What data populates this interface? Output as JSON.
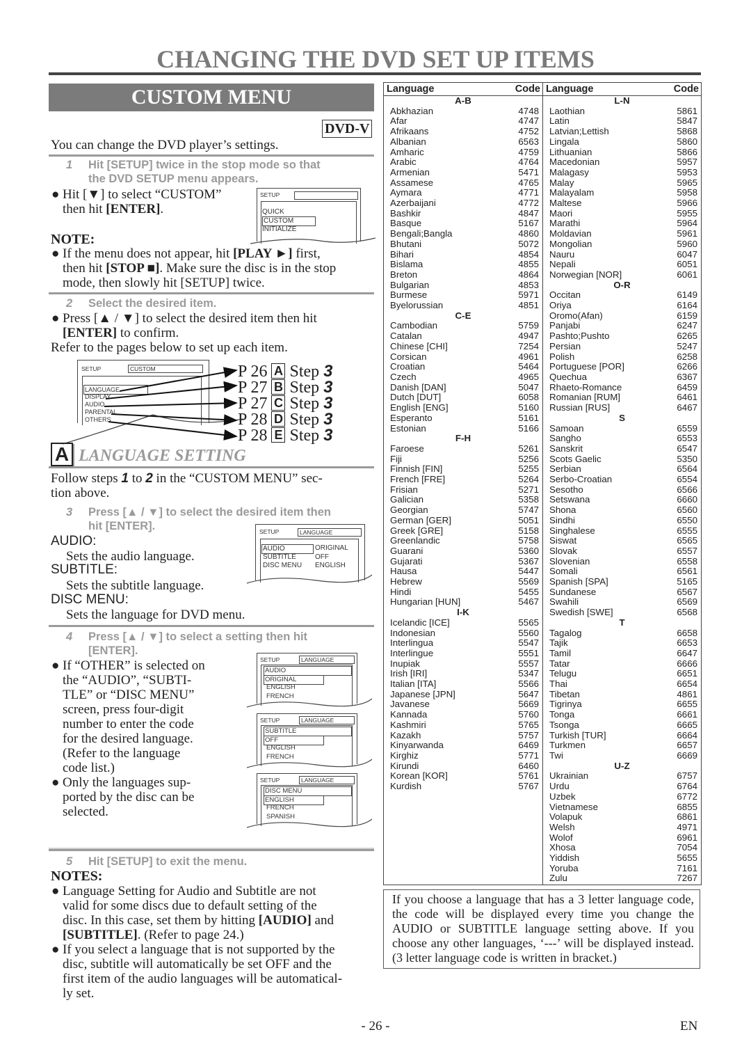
{
  "page": {
    "title": "CHANGING THE DVD SET UP ITEMS",
    "page_number": "- 26 -",
    "language_tag": "EN"
  },
  "custom_menu": {
    "banner": "CUSTOM MENU",
    "disc_badge": "DVD-V",
    "intro": "You can change the DVD player’s settings.",
    "step1": {
      "num": "1",
      "line1": "Hit [SETUP] twice in the stop mode so that",
      "line2": "the DVD SETUP menu appears."
    },
    "step1_bullet": {
      "a": "Hit [",
      "arrow": "▼",
      "b": "] to select “CUSTOM”",
      "c": "then hit ",
      "enter": "[ENTER]",
      "d": "."
    },
    "screen1": {
      "header_label": "SETUP",
      "header_value": "",
      "items": [
        "QUICK",
        "CUSTOM",
        "INITIALIZE"
      ],
      "selected": "CUSTOM"
    },
    "note": {
      "title": "NOTE:",
      "t1": "If the menu does not appear, hit ",
      "play": "[PLAY ►]",
      "t2": " first,",
      "t3": "then hit ",
      "stop": "[STOP ■]",
      "t4": ". Make sure the disc is in the stop",
      "t5": "mode, then slowly hit [SETUP] twice."
    },
    "step2": {
      "num": "2",
      "text": "Select the desired item."
    },
    "step2_bullet": {
      "a": "Press [▲ / ▼] to select the desired item then hit",
      "enter": "[ENTER]",
      "b": " to confirm."
    },
    "refer": "Refer to the pages below to set up each item.",
    "screen2": {
      "header_label": "SETUP",
      "header_value": "CUSTOM",
      "items": [
        "LANGUAGE",
        "DISPLAY",
        "AUDIO",
        "PARENTAL",
        "OTHERS"
      ]
    },
    "refs": [
      {
        "page": "P 26",
        "letter": "A",
        "step_label": "Step",
        "step_num": "3"
      },
      {
        "page": "P 27",
        "letter": "B",
        "step_label": "Step",
        "step_num": "3"
      },
      {
        "page": "P 27",
        "letter": "C",
        "step_label": "Step",
        "step_num": "3"
      },
      {
        "page": "P 28",
        "letter": "D",
        "step_label": "Step",
        "step_num": "3"
      },
      {
        "page": "P 28",
        "letter": "E",
        "step_label": "Step",
        "step_num": "3"
      }
    ]
  },
  "language_setting": {
    "letter": "A",
    "title": "LANGUAGE SETTING",
    "follow": {
      "a": "Follow steps ",
      "s1": "1",
      "b": " to ",
      "s2": "2",
      "c": " in the “CUSTOM MENU” sec-",
      "d": "tion above."
    },
    "step3": {
      "num": "3",
      "line1": "Press [▲ / ▼] to select the desired item then",
      "line2": "hit [ENTER]."
    },
    "items": [
      {
        "label": "AUDIO:",
        "desc": "Sets the audio language."
      },
      {
        "label": "SUBTITLE:",
        "desc": "Sets the subtitle language."
      },
      {
        "label": "DISC MENU:",
        "desc": "Sets the language for DVD menu."
      }
    ],
    "screen3": {
      "header_label": "SETUP",
      "header_value": "LANGUAGE",
      "rows": [
        {
          "name": "AUDIO",
          "value": "ORIGINAL"
        },
        {
          "name": "SUBTITLE",
          "value": "OFF"
        },
        {
          "name": "DISC MENU",
          "value": "ENGLISH"
        }
      ]
    },
    "step4": {
      "num": "4",
      "line1": "Press [▲ / ▼] to select a setting then hit",
      "line2": "[ENTER]."
    },
    "step4_bullets": [
      [
        "If “OTHER” is selected on",
        "the “AUDIO”, “SUBTI-",
        "TLE” or “DISC MENU”",
        "screen, press four-digit",
        "number to enter the code",
        "for the desired language.",
        "(Refer to the language",
        "code list.)"
      ],
      [
        "Only the languages sup-",
        "ported by the disc can be",
        "selected."
      ]
    ],
    "screens4": [
      {
        "header_label": "SETUP",
        "header_value": "LANGUAGE",
        "title": "AUDIO",
        "options": [
          "ORIGINAL",
          "ENGLISH",
          "FRENCH"
        ]
      },
      {
        "header_label": "SETUP",
        "header_value": "LANGUAGE",
        "title": "SUBTITLE",
        "options": [
          "OFF",
          "ENGLISH",
          "FRENCH"
        ]
      },
      {
        "header_label": "SETUP",
        "header_value": "LANGUAGE",
        "title": "DISC MENU",
        "options": [
          "ENGLISH",
          "FRENCH",
          "SPANISH"
        ]
      }
    ],
    "step5": {
      "num": "5",
      "text": "Hit [SETUP] to exit the menu."
    },
    "notes": {
      "title": "NOTES:",
      "n1": {
        "a": "Language Setting for Audio and Subtitle are not",
        "b": "valid for some discs due to default setting of the",
        "c": "disc. In this case, set them by hitting ",
        "audio": "[AUDIO]",
        "d": " and",
        "subtitle": "[SUBTITLE]",
        "e": ". (Refer to page 24.)"
      },
      "n2": [
        "If you select a language that is not supported by the",
        "disc, subtitle will automatically be set OFF and the",
        "first item of the audio languages will be automatical-",
        "ly set."
      ]
    }
  },
  "language_table": {
    "headers": {
      "language": "Language",
      "code": "Code"
    },
    "columns": [
      [
        {
          "group": "A-B"
        },
        {
          "name": "Abkhazian",
          "code": "4748"
        },
        {
          "name": "Afar",
          "code": "4747"
        },
        {
          "name": "Afrikaans",
          "code": "4752"
        },
        {
          "name": "Albanian",
          "code": "6563"
        },
        {
          "name": "Amharic",
          "code": "4759"
        },
        {
          "name": "Arabic",
          "code": "4764"
        },
        {
          "name": "Armenian",
          "code": "5471"
        },
        {
          "name": "Assamese",
          "code": "4765"
        },
        {
          "name": "Aymara",
          "code": "4771"
        },
        {
          "name": "Azerbaijani",
          "code": "4772"
        },
        {
          "name": "Bashkir",
          "code": "4847"
        },
        {
          "name": "Basque",
          "code": "5167"
        },
        {
          "name": "Bengali;Bangla",
          "code": "4860"
        },
        {
          "name": "Bhutani",
          "code": "5072"
        },
        {
          "name": "Bihari",
          "code": "4854"
        },
        {
          "name": "Bislama",
          "code": "4855"
        },
        {
          "name": "Breton",
          "code": "4864"
        },
        {
          "name": "Bulgarian",
          "code": "4853"
        },
        {
          "name": "Burmese",
          "code": "5971"
        },
        {
          "name": "Byelorussian",
          "code": "4851"
        },
        {
          "group": "C-E"
        },
        {
          "name": "Cambodian",
          "code": "5759"
        },
        {
          "name": "Catalan",
          "code": "4947"
        },
        {
          "name": "Chinese [CHI]",
          "code": "7254"
        },
        {
          "name": "Corsican",
          "code": "4961"
        },
        {
          "name": "Croatian",
          "code": "5464"
        },
        {
          "name": "Czech",
          "code": "4965"
        },
        {
          "name": "Danish [DAN]",
          "code": "5047"
        },
        {
          "name": "Dutch [DUT]",
          "code": "6058"
        },
        {
          "name": "English [ENG]",
          "code": "5160"
        },
        {
          "name": "Esperanto",
          "code": "5161"
        },
        {
          "name": "Estonian",
          "code": "5166"
        },
        {
          "group": "F-H"
        },
        {
          "name": "Faroese",
          "code": "5261"
        },
        {
          "name": "Fiji",
          "code": "5256"
        },
        {
          "name": "Finnish [FIN]",
          "code": "5255"
        },
        {
          "name": "French [FRE]",
          "code": "5264"
        },
        {
          "name": "Frisian",
          "code": "5271"
        },
        {
          "name": "Galician",
          "code": "5358"
        },
        {
          "name": "Georgian",
          "code": "5747"
        },
        {
          "name": "German [GER]",
          "code": "5051"
        },
        {
          "name": "Greek [GRE]",
          "code": "5158"
        },
        {
          "name": "Greenlandic",
          "code": "5758"
        },
        {
          "name": "Guarani",
          "code": "5360"
        },
        {
          "name": "Gujarati",
          "code": "5367"
        },
        {
          "name": "Hausa",
          "code": "5447"
        },
        {
          "name": "Hebrew",
          "code": "5569"
        },
        {
          "name": "Hindi",
          "code": "5455"
        },
        {
          "name": "Hungarian [HUN]",
          "code": "5467"
        },
        {
          "group": "I-K"
        },
        {
          "name": "Icelandic [ICE]",
          "code": "5565"
        },
        {
          "name": "Indonesian",
          "code": "5560"
        },
        {
          "name": "Interlingua",
          "code": "5547"
        },
        {
          "name": "Interlingue",
          "code": "5551"
        },
        {
          "name": "Inupiak",
          "code": "5557"
        },
        {
          "name": "Irish [IRI]",
          "code": "5347"
        },
        {
          "name": "Italian [ITA]",
          "code": "5566"
        },
        {
          "name": "Japanese [JPN]",
          "code": "5647"
        },
        {
          "name": "Javanese",
          "code": "5669"
        },
        {
          "name": "Kannada",
          "code": "5760"
        },
        {
          "name": "Kashmiri",
          "code": "5765"
        },
        {
          "name": "Kazakh",
          "code": "5757"
        },
        {
          "name": "Kinyarwanda",
          "code": "6469"
        },
        {
          "name": "Kirghiz",
          "code": "5771"
        },
        {
          "name": "Kirundi",
          "code": "6460"
        },
        {
          "name": "Korean [KOR]",
          "code": "5761"
        },
        {
          "name": "Kurdish",
          "code": "5767"
        }
      ],
      [
        {
          "group": "L-N"
        },
        {
          "name": "Laothian",
          "code": "5861"
        },
        {
          "name": "Latin",
          "code": "5847"
        },
        {
          "name": "Latvian;Lettish",
          "code": "5868"
        },
        {
          "name": "Lingala",
          "code": "5860"
        },
        {
          "name": "Lithuanian",
          "code": "5866"
        },
        {
          "name": "Macedonian",
          "code": "5957"
        },
        {
          "name": "Malagasy",
          "code": "5953"
        },
        {
          "name": "Malay",
          "code": "5965"
        },
        {
          "name": "Malayalam",
          "code": "5958"
        },
        {
          "name": "Maltese",
          "code": "5966"
        },
        {
          "name": "Maori",
          "code": "5955"
        },
        {
          "name": "Marathi",
          "code": "5964"
        },
        {
          "name": "Moldavian",
          "code": "5961"
        },
        {
          "name": "Mongolian",
          "code": "5960"
        },
        {
          "name": "Nauru",
          "code": "6047"
        },
        {
          "name": "Nepali",
          "code": "6051"
        },
        {
          "name": "Norwegian [NOR]",
          "code": "6061"
        },
        {
          "group": "O-R"
        },
        {
          "name": "Occitan",
          "code": "6149"
        },
        {
          "name": "Oriya",
          "code": "6164"
        },
        {
          "name": "Oromo(Afan)",
          "code": "6159"
        },
        {
          "name": "Panjabi",
          "code": "6247"
        },
        {
          "name": "Pashto;Pushto",
          "code": "6265"
        },
        {
          "name": "Persian",
          "code": "5247"
        },
        {
          "name": "Polish",
          "code": "6258"
        },
        {
          "name": "Portuguese [POR]",
          "code": "6266"
        },
        {
          "name": "Quechua",
          "code": "6367"
        },
        {
          "name": "Rhaeto-Romance",
          "code": "6459"
        },
        {
          "name": "Romanian [RUM]",
          "code": "6461"
        },
        {
          "name": "Russian [RUS]",
          "code": "6467"
        },
        {
          "group": "S"
        },
        {
          "name": "Samoan",
          "code": "6559"
        },
        {
          "name": "Sangho",
          "code": "6553"
        },
        {
          "name": "Sanskrit",
          "code": "6547"
        },
        {
          "name": "Scots Gaelic",
          "code": "5350"
        },
        {
          "name": "Serbian",
          "code": "6564"
        },
        {
          "name": "Serbo-Croatian",
          "code": "6554"
        },
        {
          "name": "Sesotho",
          "code": "6566"
        },
        {
          "name": "Setswana",
          "code": "6660"
        },
        {
          "name": "Shona",
          "code": "6560"
        },
        {
          "name": "Sindhi",
          "code": "6550"
        },
        {
          "name": "Singhalese",
          "code": "6555"
        },
        {
          "name": "Siswat",
          "code": "6565"
        },
        {
          "name": "Slovak",
          "code": "6557"
        },
        {
          "name": "Slovenian",
          "code": "6558"
        },
        {
          "name": "Somali",
          "code": "6561"
        },
        {
          "name": "Spanish [SPA]",
          "code": "5165"
        },
        {
          "name": "Sundanese",
          "code": "6567"
        },
        {
          "name": "Swahili",
          "code": "6569"
        },
        {
          "name": "Swedish [SWE]",
          "code": "6568"
        },
        {
          "group": "T"
        },
        {
          "name": "Tagalog",
          "code": "6658"
        },
        {
          "name": "Tajik",
          "code": "6653"
        },
        {
          "name": "Tamil",
          "code": "6647"
        },
        {
          "name": "Tatar",
          "code": "6666"
        },
        {
          "name": "Telugu",
          "code": "6651"
        },
        {
          "name": "Thai",
          "code": "6654"
        },
        {
          "name": "Tibetan",
          "code": "4861"
        },
        {
          "name": "Tigrinya",
          "code": "6655"
        },
        {
          "name": "Tonga",
          "code": "6661"
        },
        {
          "name": "Tsonga",
          "code": "6665"
        },
        {
          "name": "Turkish [TUR]",
          "code": "6664"
        },
        {
          "name": "Turkmen",
          "code": "6657"
        },
        {
          "name": "Twi",
          "code": "6669"
        },
        {
          "group": "U-Z"
        },
        {
          "name": "Ukrainian",
          "code": "6757"
        },
        {
          "name": "Urdu",
          "code": "6764"
        },
        {
          "name": "Uzbek",
          "code": "6772"
        },
        {
          "name": "Vietnamese",
          "code": "6855"
        },
        {
          "name": "Volapuk",
          "code": "6861"
        },
        {
          "name": "Welsh",
          "code": "4971"
        },
        {
          "name": "Wolof",
          "code": "6961"
        },
        {
          "name": "Xhosa",
          "code": "7054"
        },
        {
          "name": "Yiddish",
          "code": "5655"
        },
        {
          "name": "Yoruba",
          "code": "7161"
        },
        {
          "name": "Zulu",
          "code": "7267"
        }
      ]
    ]
  },
  "footnote_box": "If you choose a language that has a 3 letter language code, the code will be displayed every time you change the AUDIO or SUBTITLE language setting above. If you choose any other languages, ‘---’ will be displayed instead. (3 letter language code is written in bracket.)"
}
